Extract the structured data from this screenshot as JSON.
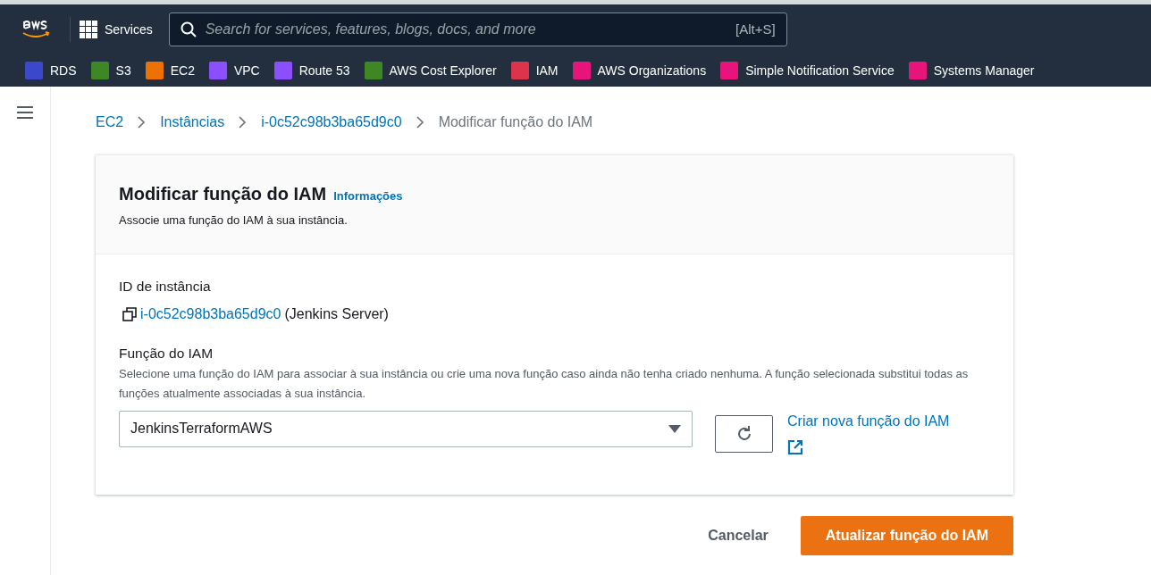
{
  "top_nav": {
    "services_label": "Services",
    "search": {
      "placeholder": "Search for services, features, blogs, docs, and more",
      "shortcut": "[Alt+S]"
    }
  },
  "favorites": [
    {
      "label": "RDS",
      "color": "#3b48cc"
    },
    {
      "label": "S3",
      "color": "#3f8624"
    },
    {
      "label": "EC2",
      "color": "#ed7100"
    },
    {
      "label": "VPC",
      "color": "#8c4fff"
    },
    {
      "label": "Route 53",
      "color": "#8c4fff"
    },
    {
      "label": "AWS Cost Explorer",
      "color": "#3f8624"
    },
    {
      "label": "IAM",
      "color": "#dd344c"
    },
    {
      "label": "AWS Organizations",
      "color": "#e7157b"
    },
    {
      "label": "Simple Notification Service",
      "color": "#e7157b"
    },
    {
      "label": "Systems Manager",
      "color": "#e7157b"
    }
  ],
  "breadcrumb": [
    {
      "label": "EC2",
      "link": true
    },
    {
      "label": "Instâncias",
      "link": true
    },
    {
      "label": "i-0c52c98b3ba65d9c0",
      "link": true
    },
    {
      "label": "Modificar função do IAM",
      "link": false
    }
  ],
  "panel": {
    "title": "Modificar função do IAM",
    "info_link": "Informações",
    "description": "Associe uma função do IAM à sua instância.",
    "instance_label": "ID de instância",
    "instance_id": "i-0c52c98b3ba65d9c0",
    "instance_name": "(Jenkins Server)",
    "role_label": "Função do IAM",
    "role_help": "Selecione uma função do IAM para associar à sua instância ou crie uma nova função caso ainda não tenha criado nenhuma. A função selecionada substitui todas as funções atualmente associadas à sua instância.",
    "role_value": "JenkinsTerraformAWS",
    "create_link": "Criar nova função do IAM"
  },
  "actions": [
    {
      "label": "Cancelar",
      "kind": "link"
    },
    {
      "label": "Atualizar função do IAM",
      "kind": "primary"
    }
  ]
}
